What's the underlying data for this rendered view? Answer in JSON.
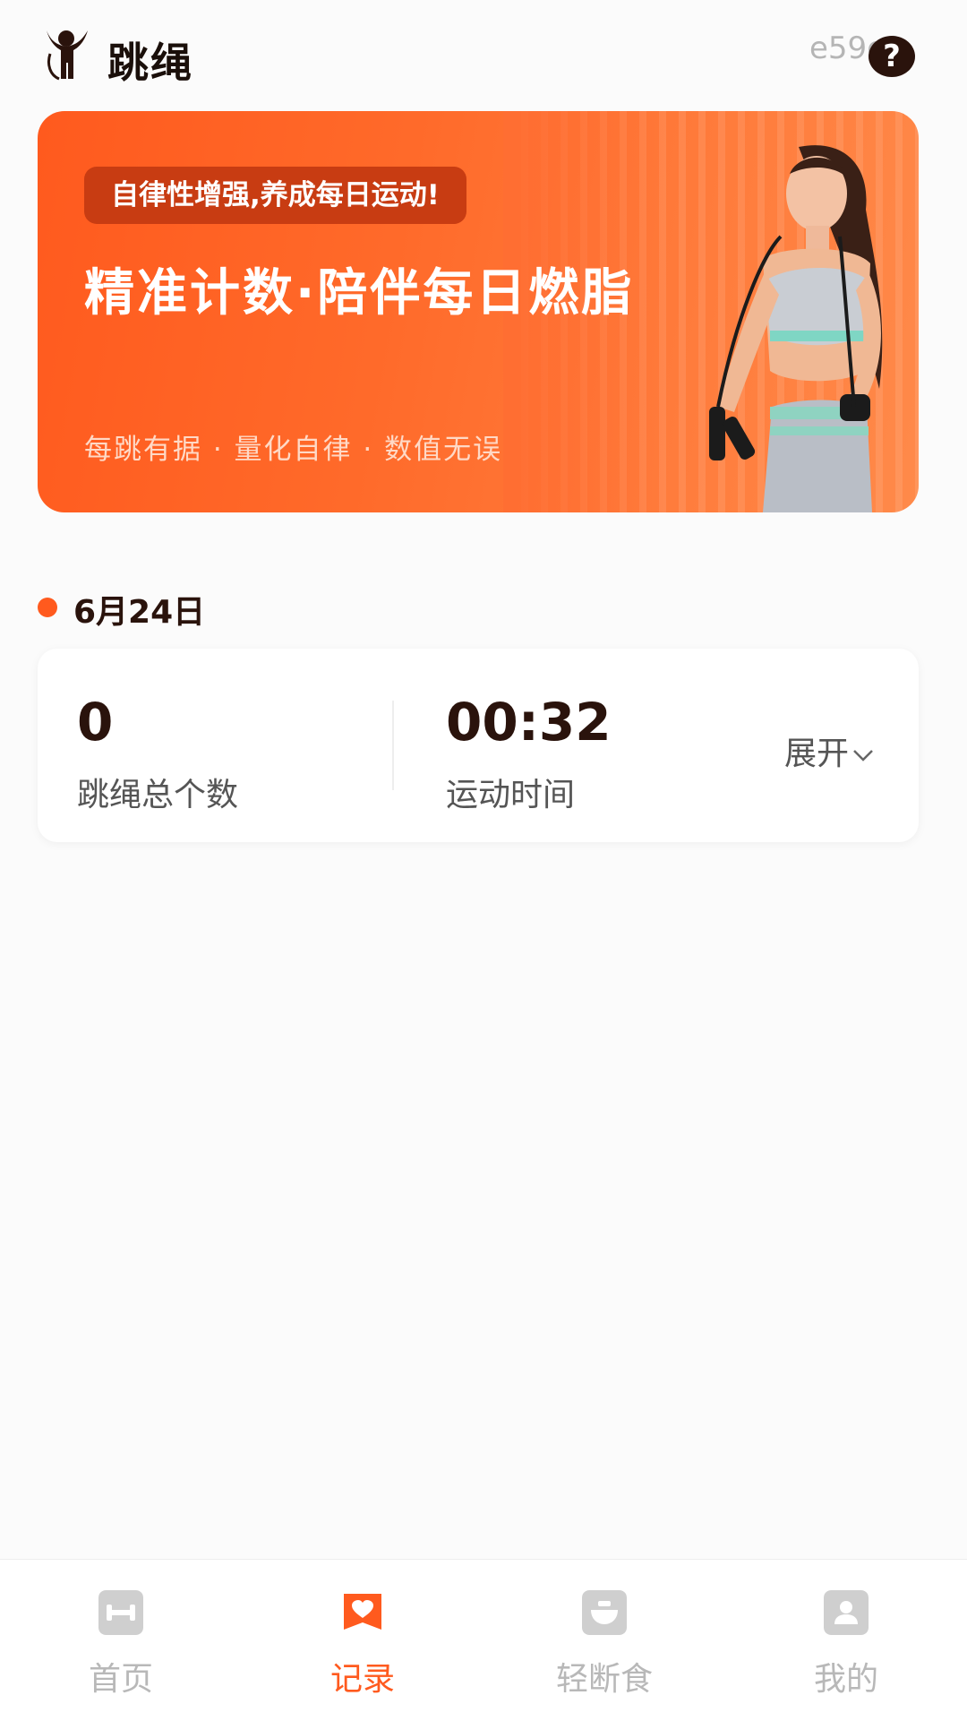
{
  "header": {
    "title": "跳绳",
    "watermark": "e59c8",
    "help_glyph": "?"
  },
  "banner": {
    "pill_text": "自律性增强,养成每日运动!",
    "headline": "精准计数·陪伴每日燃脂",
    "tagline": "每跳有据 · 量化自律 · 数值无误"
  },
  "date": {
    "label": "6月24日",
    "accent_color": "#ff5a1e"
  },
  "stats": {
    "jump_count_value": "0",
    "jump_count_label": "跳绳总个数",
    "duration_value": "00:32",
    "duration_label": "运动时间",
    "expand_label": "展开"
  },
  "bottom_nav": {
    "items": [
      {
        "label": "首页",
        "icon": "dumbbell-icon",
        "active": false
      },
      {
        "label": "记录",
        "icon": "heart-record-icon",
        "active": true
      },
      {
        "label": "轻断食",
        "icon": "food-bowl-icon",
        "active": false
      },
      {
        "label": "我的",
        "icon": "profile-icon",
        "active": false
      }
    ]
  },
  "colors": {
    "brand": "#ff5a1e",
    "text_dark": "#2a130c",
    "inactive": "#b8b8b8"
  }
}
